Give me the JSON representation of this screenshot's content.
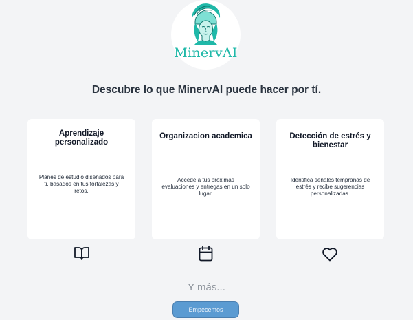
{
  "logo": {
    "text": "MinervAI",
    "icon": "minerva-helmet-logo",
    "accent": "#1fb8a8"
  },
  "headline": "Descubre lo que MinervAI puede hacer por tí.",
  "cards": [
    {
      "title": "Aprendizaje personalizado",
      "description": "Planes de estudio diseñados para ti, basados en tus fortalezas y retos.",
      "icon": "book-open-icon"
    },
    {
      "title": "Organizacion academica",
      "description": "Accede a tus próximas evaluaciones y entregas en un solo lugar.",
      "icon": "calendar-icon"
    },
    {
      "title": "Detección de estrés y bienestar",
      "description": "Identifica señales tempranas de estrés y recibe sugerencias personalizadas.",
      "icon": "heart-icon"
    }
  ],
  "more_text": "Y más...",
  "cta_label": "Empecemos",
  "colors": {
    "background": "#f3f4f6",
    "card": "#ffffff",
    "button": "#5b9bd2"
  }
}
